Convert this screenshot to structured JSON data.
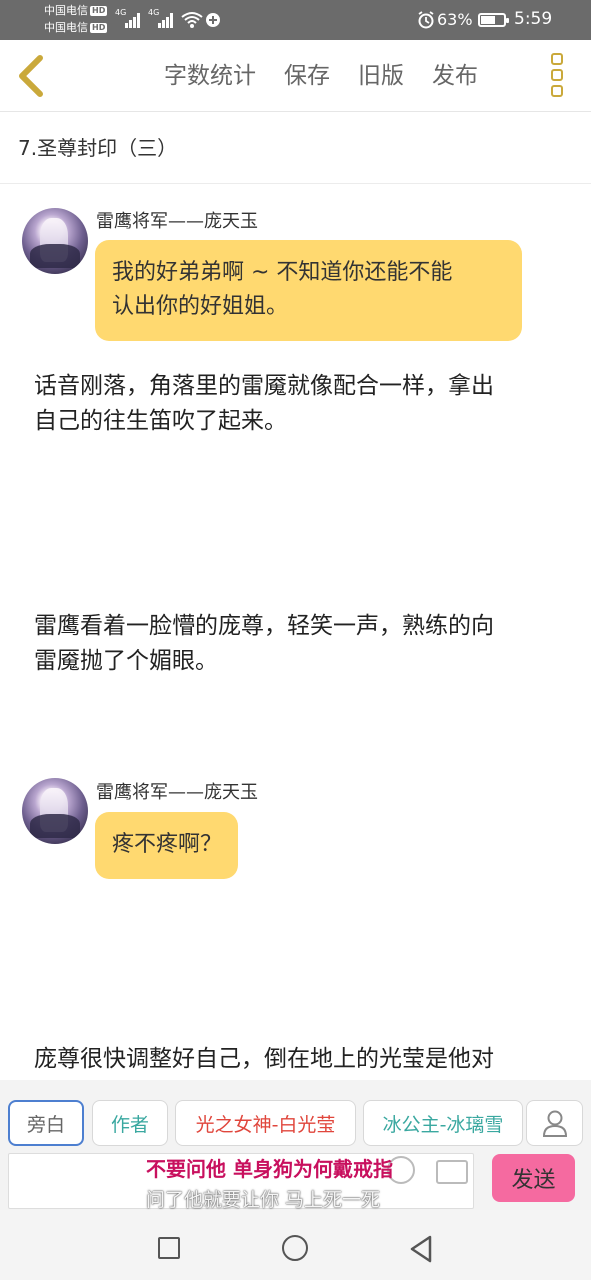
{
  "status_bar": {
    "carrier_1": "中国电信",
    "carrier_2": "中国电信",
    "hd": "HD",
    "network_1": "4G",
    "network_2": "4G",
    "battery_percent": "63%",
    "battery_level": 0.63,
    "time": "5:59"
  },
  "toolbar": {
    "word_count_label": "字数统计",
    "save_label": "保存",
    "old_version_label": "旧版",
    "publish_label": "发布"
  },
  "chapter": {
    "title": "7.圣尊封印（三）"
  },
  "content": {
    "dialogue_1": {
      "speaker": "雷鹰将军——庞天玉",
      "line_1": "我的好弟弟啊 ~ 不知道你还能不能",
      "line_2": "认出你的好姐姐。"
    },
    "narration_1": {
      "line_1": "话音刚落，角落里的雷魇就像配合一样，拿出",
      "line_2": "自己的往生笛吹了起来。"
    },
    "narration_2": {
      "line_1": "雷鹰看着一脸懵的庞尊，轻笑一声，熟练的向",
      "line_2": "雷魇抛了个媚眼。"
    },
    "dialogue_2": {
      "speaker": "雷鹰将军——庞天玉",
      "line_1": "疼不疼啊？"
    },
    "narration_3": {
      "line_1": "庞尊很快调整好自己，倒在地上的光莹是他对"
    }
  },
  "character_bar": {
    "chips": [
      {
        "label": "旁白",
        "color": "#666666"
      },
      {
        "label": "作者",
        "color": "#3aa8a0"
      },
      {
        "label": "光之女神-白光莹",
        "color": "#e0463c"
      },
      {
        "label": "冰公主-冰璃雪",
        "color": "#3aa8a0"
      }
    ],
    "user_icon": "user-icon"
  },
  "input_bar": {
    "placeholder": "",
    "send_label": "发送",
    "overlay_line_1": "不要问他 单身狗为何戴戒指",
    "overlay_line_2": "问了他就要让你 马上死一死"
  },
  "nav_bar": {
    "icons": [
      "recent-apps-icon",
      "home-icon",
      "back-icon"
    ]
  },
  "colors": {
    "bubble": "#ffd970",
    "send": "#f56aa0",
    "accent": "#caa93b",
    "selected_chip": "#4d7fd0"
  }
}
